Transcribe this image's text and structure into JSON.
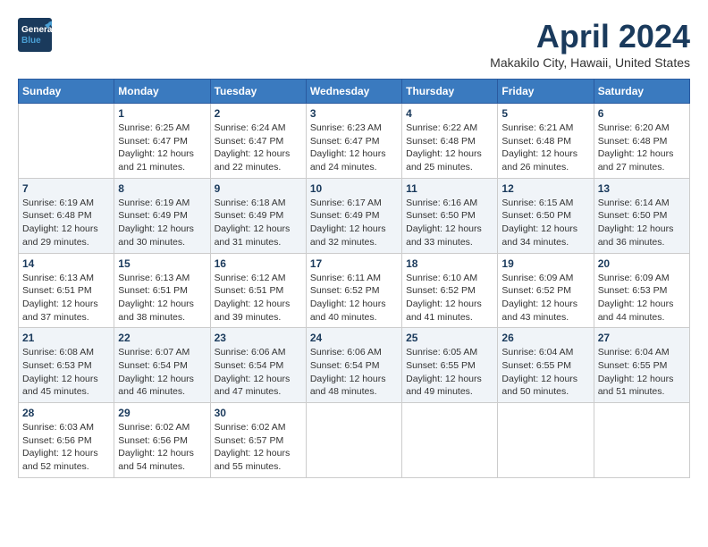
{
  "header": {
    "logo_line1": "General",
    "logo_line2": "Blue",
    "main_title": "April 2024",
    "subtitle": "Makakilo City, Hawaii, United States"
  },
  "calendar": {
    "days_of_week": [
      "Sunday",
      "Monday",
      "Tuesday",
      "Wednesday",
      "Thursday",
      "Friday",
      "Saturday"
    ],
    "weeks": [
      [
        {
          "day": "",
          "info": ""
        },
        {
          "day": "1",
          "info": "Sunrise: 6:25 AM\nSunset: 6:47 PM\nDaylight: 12 hours and 21 minutes."
        },
        {
          "day": "2",
          "info": "Sunrise: 6:24 AM\nSunset: 6:47 PM\nDaylight: 12 hours and 22 minutes."
        },
        {
          "day": "3",
          "info": "Sunrise: 6:23 AM\nSunset: 6:47 PM\nDaylight: 12 hours and 24 minutes."
        },
        {
          "day": "4",
          "info": "Sunrise: 6:22 AM\nSunset: 6:48 PM\nDaylight: 12 hours and 25 minutes."
        },
        {
          "day": "5",
          "info": "Sunrise: 6:21 AM\nSunset: 6:48 PM\nDaylight: 12 hours and 26 minutes."
        },
        {
          "day": "6",
          "info": "Sunrise: 6:20 AM\nSunset: 6:48 PM\nDaylight: 12 hours and 27 minutes."
        }
      ],
      [
        {
          "day": "7",
          "info": "Sunrise: 6:19 AM\nSunset: 6:48 PM\nDaylight: 12 hours and 29 minutes."
        },
        {
          "day": "8",
          "info": "Sunrise: 6:19 AM\nSunset: 6:49 PM\nDaylight: 12 hours and 30 minutes."
        },
        {
          "day": "9",
          "info": "Sunrise: 6:18 AM\nSunset: 6:49 PM\nDaylight: 12 hours and 31 minutes."
        },
        {
          "day": "10",
          "info": "Sunrise: 6:17 AM\nSunset: 6:49 PM\nDaylight: 12 hours and 32 minutes."
        },
        {
          "day": "11",
          "info": "Sunrise: 6:16 AM\nSunset: 6:50 PM\nDaylight: 12 hours and 33 minutes."
        },
        {
          "day": "12",
          "info": "Sunrise: 6:15 AM\nSunset: 6:50 PM\nDaylight: 12 hours and 34 minutes."
        },
        {
          "day": "13",
          "info": "Sunrise: 6:14 AM\nSunset: 6:50 PM\nDaylight: 12 hours and 36 minutes."
        }
      ],
      [
        {
          "day": "14",
          "info": "Sunrise: 6:13 AM\nSunset: 6:51 PM\nDaylight: 12 hours and 37 minutes."
        },
        {
          "day": "15",
          "info": "Sunrise: 6:13 AM\nSunset: 6:51 PM\nDaylight: 12 hours and 38 minutes."
        },
        {
          "day": "16",
          "info": "Sunrise: 6:12 AM\nSunset: 6:51 PM\nDaylight: 12 hours and 39 minutes."
        },
        {
          "day": "17",
          "info": "Sunrise: 6:11 AM\nSunset: 6:52 PM\nDaylight: 12 hours and 40 minutes."
        },
        {
          "day": "18",
          "info": "Sunrise: 6:10 AM\nSunset: 6:52 PM\nDaylight: 12 hours and 41 minutes."
        },
        {
          "day": "19",
          "info": "Sunrise: 6:09 AM\nSunset: 6:52 PM\nDaylight: 12 hours and 43 minutes."
        },
        {
          "day": "20",
          "info": "Sunrise: 6:09 AM\nSunset: 6:53 PM\nDaylight: 12 hours and 44 minutes."
        }
      ],
      [
        {
          "day": "21",
          "info": "Sunrise: 6:08 AM\nSunset: 6:53 PM\nDaylight: 12 hours and 45 minutes."
        },
        {
          "day": "22",
          "info": "Sunrise: 6:07 AM\nSunset: 6:54 PM\nDaylight: 12 hours and 46 minutes."
        },
        {
          "day": "23",
          "info": "Sunrise: 6:06 AM\nSunset: 6:54 PM\nDaylight: 12 hours and 47 minutes."
        },
        {
          "day": "24",
          "info": "Sunrise: 6:06 AM\nSunset: 6:54 PM\nDaylight: 12 hours and 48 minutes."
        },
        {
          "day": "25",
          "info": "Sunrise: 6:05 AM\nSunset: 6:55 PM\nDaylight: 12 hours and 49 minutes."
        },
        {
          "day": "26",
          "info": "Sunrise: 6:04 AM\nSunset: 6:55 PM\nDaylight: 12 hours and 50 minutes."
        },
        {
          "day": "27",
          "info": "Sunrise: 6:04 AM\nSunset: 6:55 PM\nDaylight: 12 hours and 51 minutes."
        }
      ],
      [
        {
          "day": "28",
          "info": "Sunrise: 6:03 AM\nSunset: 6:56 PM\nDaylight: 12 hours and 52 minutes."
        },
        {
          "day": "29",
          "info": "Sunrise: 6:02 AM\nSunset: 6:56 PM\nDaylight: 12 hours and 54 minutes."
        },
        {
          "day": "30",
          "info": "Sunrise: 6:02 AM\nSunset: 6:57 PM\nDaylight: 12 hours and 55 minutes."
        },
        {
          "day": "",
          "info": ""
        },
        {
          "day": "",
          "info": ""
        },
        {
          "day": "",
          "info": ""
        },
        {
          "day": "",
          "info": ""
        }
      ]
    ]
  }
}
